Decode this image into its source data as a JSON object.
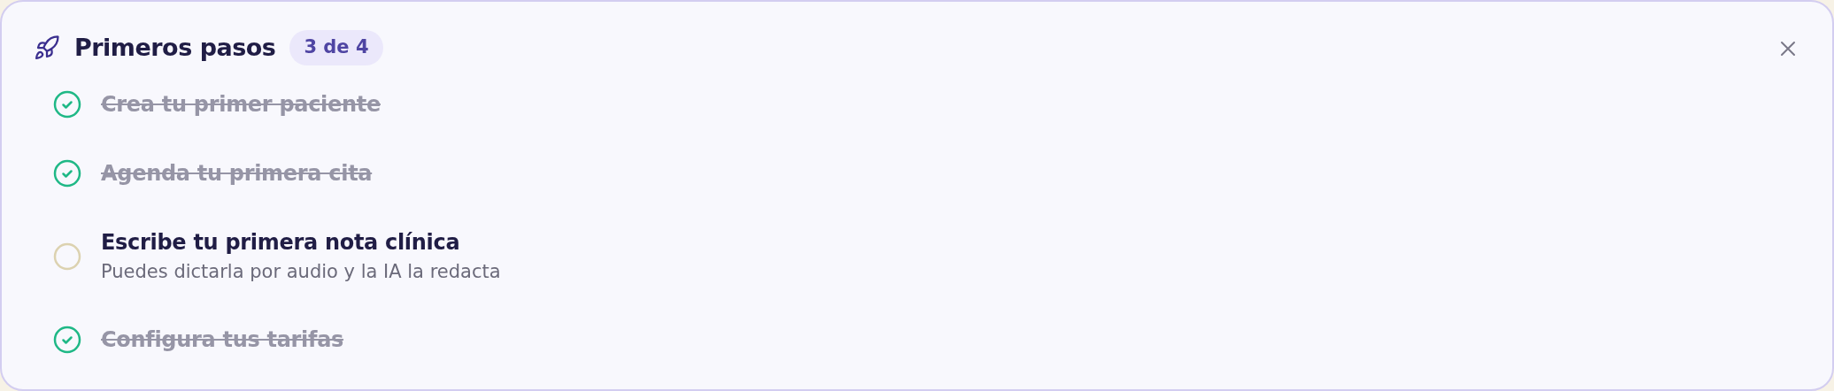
{
  "title": "Primeros pasos",
  "progress": "3 de 4",
  "steps": [
    {
      "label": "Crea tu primer paciente",
      "checked": true
    },
    {
      "label": "Agenda tu primera cita",
      "checked": true
    },
    {
      "label": "Escribe tu primera nota clínica",
      "checked": false,
      "description": "Puedes dictarla por audio y la IA la redacta"
    },
    {
      "label": "Configura tus tarifas",
      "checked": true
    }
  ]
}
